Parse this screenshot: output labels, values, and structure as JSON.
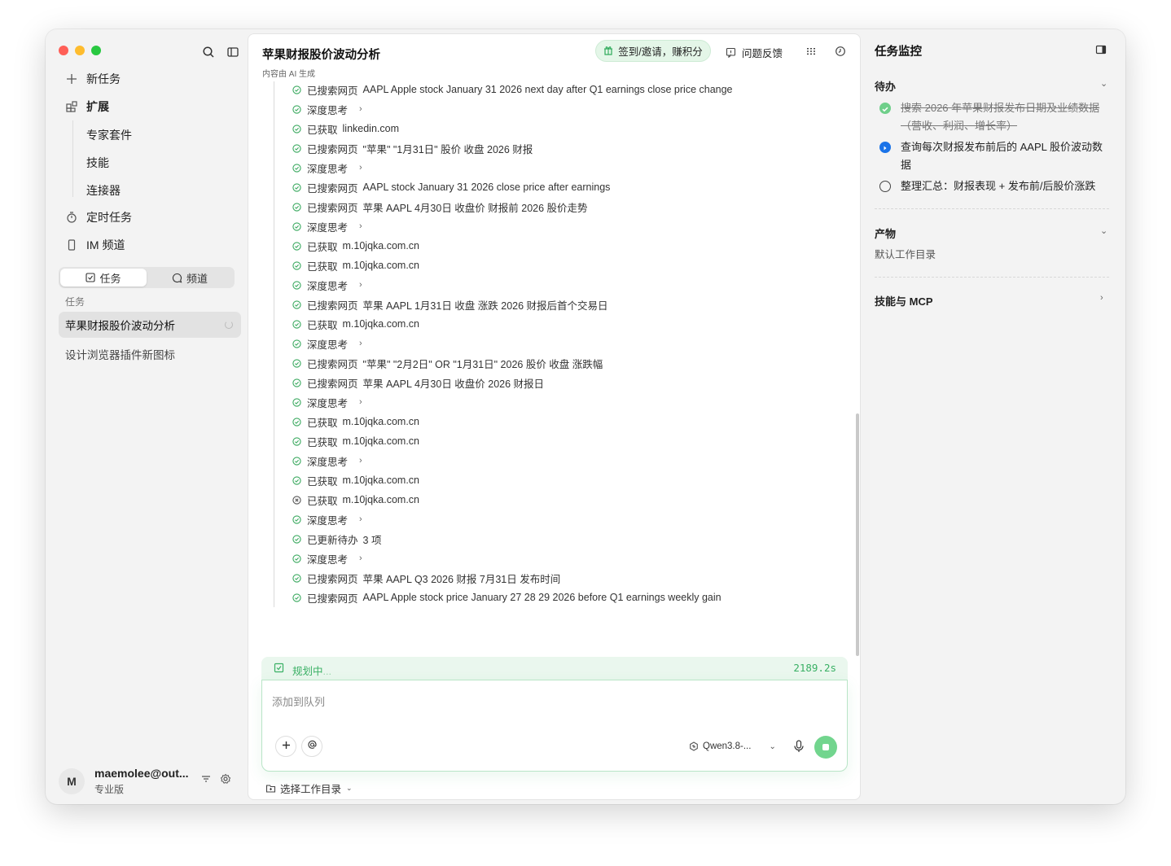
{
  "sidebar": {
    "new_task": "新任务",
    "extensions": "扩展",
    "ext_items": [
      "专家套件",
      "技能",
      "连接器"
    ],
    "scheduled": "定时任务",
    "im_channel": "IM 频道",
    "tabs": {
      "tasks": "任务",
      "channels": "频道"
    },
    "section_label": "任务",
    "tasks": [
      {
        "title": "苹果财报股价波动分析",
        "status": "running"
      },
      {
        "title": "设计浏览器插件新图标",
        "status": "idle"
      }
    ],
    "user": {
      "initial": "M",
      "name": "maemolee@out...",
      "plan": "专业版"
    }
  },
  "main": {
    "title": "苹果财报股价波动分析",
    "subtitle": "内容由 AI 生成",
    "checkin": "签到/邀请，赚积分",
    "feedback": "问题反馈",
    "steps": [
      {
        "label": "已搜索网页",
        "text": "AAPL Apple stock January 31 2026 next day after Q1 earnings close price change",
        "status": "ok"
      },
      {
        "label": "深度思考",
        "text": "",
        "status": "ok",
        "expand": true
      },
      {
        "label": "已获取",
        "text": "linkedin.com",
        "status": "ok"
      },
      {
        "label": "已搜索网页",
        "text": "\"苹果\" \"1月31日\" 股价 收盘 2026 财报",
        "status": "ok"
      },
      {
        "label": "深度思考",
        "text": "",
        "status": "ok",
        "expand": true
      },
      {
        "label": "已搜索网页",
        "text": "AAPL stock January 31 2026 close price after earnings",
        "status": "ok"
      },
      {
        "label": "已搜索网页",
        "text": "苹果 AAPL 4月30日 收盘价 财报前 2026 股价走势",
        "status": "ok"
      },
      {
        "label": "深度思考",
        "text": "",
        "status": "ok",
        "expand": true
      },
      {
        "label": "已获取",
        "text": "m.10jqka.com.cn",
        "status": "ok"
      },
      {
        "label": "已获取",
        "text": "m.10jqka.com.cn",
        "status": "ok"
      },
      {
        "label": "深度思考",
        "text": "",
        "status": "ok",
        "expand": true
      },
      {
        "label": "已搜索网页",
        "text": "苹果 AAPL 1月31日 收盘 涨跌 2026 财报后首个交易日",
        "status": "ok"
      },
      {
        "label": "已获取",
        "text": "m.10jqka.com.cn",
        "status": "ok"
      },
      {
        "label": "深度思考",
        "text": "",
        "status": "ok",
        "expand": true
      },
      {
        "label": "已搜索网页",
        "text": "\"苹果\" \"2月2日\" OR \"1月31日\" 2026 股价 收盘 涨跌幅",
        "status": "ok"
      },
      {
        "label": "已搜索网页",
        "text": "苹果 AAPL 4月30日 收盘价 2026 财报日",
        "status": "ok"
      },
      {
        "label": "深度思考",
        "text": "",
        "status": "ok",
        "expand": true
      },
      {
        "label": "已获取",
        "text": "m.10jqka.com.cn",
        "status": "ok"
      },
      {
        "label": "已获取",
        "text": "m.10jqka.com.cn",
        "status": "ok"
      },
      {
        "label": "深度思考",
        "text": "",
        "status": "ok",
        "expand": true
      },
      {
        "label": "已获取",
        "text": "m.10jqka.com.cn",
        "status": "ok"
      },
      {
        "label": "已获取",
        "text": "m.10jqka.com.cn",
        "status": "error"
      },
      {
        "label": "深度思考",
        "text": "",
        "status": "ok",
        "expand": true
      },
      {
        "label": "已更新待办",
        "text": "3 项",
        "status": "ok"
      },
      {
        "label": "深度思考",
        "text": "",
        "status": "ok",
        "expand": true
      },
      {
        "label": "已搜索网页",
        "text": "苹果 AAPL Q3 2026 财报 7月31日 发布时间",
        "status": "ok"
      },
      {
        "label": "已搜索网页",
        "text": "AAPL Apple stock price January 27 28 29 2026 before Q1 earnings weekly gain",
        "status": "ok"
      }
    ],
    "planning": {
      "label": "规划中",
      "dots": "...",
      "elapsed": "2189.2s"
    },
    "composer": {
      "placeholder": "添加到队列",
      "model": "Qwen3.8-..."
    },
    "workdir": "选择工作目录"
  },
  "right": {
    "title": "任务监控",
    "todo_header": "待办",
    "todos": [
      {
        "text": "搜索 2026 年苹果财报发布日期及业绩数据（营收、利润、增长率）",
        "status": "done"
      },
      {
        "text": "查询每次财报发布前后的 AAPL 股价波动数据",
        "status": "active"
      },
      {
        "text": "整理汇总：财报表现 + 发布前/后股价涨跌",
        "status": "pending"
      }
    ],
    "artifacts_header": "产物",
    "artifacts_text": "默认工作目录",
    "skills_header": "技能与 MCP"
  },
  "colors": {
    "accent_green": "#39b064",
    "active_blue": "#1a73e8",
    "done_green": "#6fcf8a"
  },
  "icons": [
    "search-icon",
    "sidebar-toggle-icon",
    "plus-icon",
    "extension-icon",
    "timer-icon",
    "phone-icon",
    "checkbox-icon",
    "chat-icon",
    "filter-icon",
    "settings-icon",
    "gift-icon",
    "feedback-icon",
    "grid-icon",
    "clock-icon",
    "check-circle-icon",
    "x-circle-icon",
    "clipboard-check-icon",
    "at-icon",
    "model-icon",
    "microphone-icon",
    "stop-icon",
    "folder-icon",
    "chevron-down-icon",
    "chevron-right-icon"
  ]
}
